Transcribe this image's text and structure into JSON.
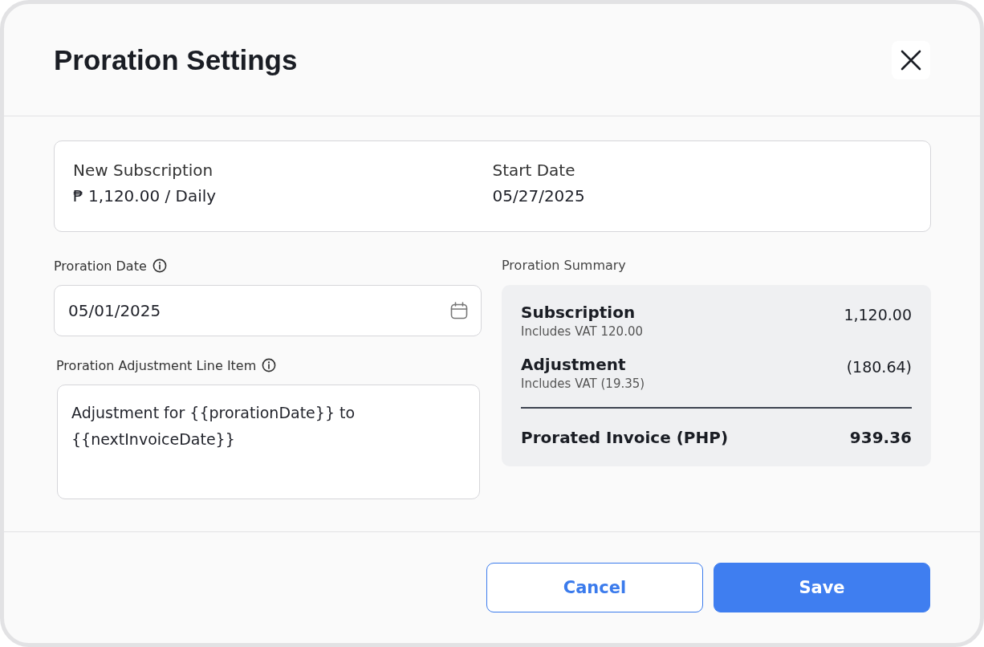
{
  "dialog": {
    "title": "Proration Settings"
  },
  "subscription_card": {
    "fields": [
      {
        "label": "New Subscription",
        "value": "₱ 1,120.00 / Daily"
      },
      {
        "label": "Start Date",
        "value": "05/27/2025"
      }
    ]
  },
  "proration_date": {
    "label": "Proration Date",
    "value": "05/01/2025"
  },
  "line_item": {
    "label": "Proration Adjustment Line Item",
    "value": "Adjustment for {{prorationDate}} to {{nextInvoiceDate}}"
  },
  "summary": {
    "heading": "Proration Summary",
    "items": [
      {
        "name": "Subscription",
        "note": "Includes VAT 120.00",
        "amount": "1,120.00"
      },
      {
        "name": "Adjustment",
        "note": "Includes VAT (19.35)",
        "amount": "(180.64)"
      }
    ],
    "total": {
      "label": "Prorated Invoice (PHP)",
      "amount": "939.36"
    }
  },
  "buttons": [
    {
      "label": "Cancel",
      "kind": "secondary"
    },
    {
      "label": "Save",
      "kind": "primary"
    }
  ]
}
